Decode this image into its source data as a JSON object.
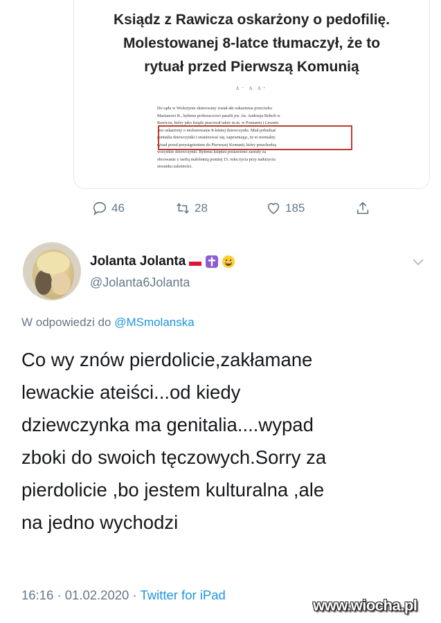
{
  "quoted_article": {
    "title_lines": [
      "Ksiądz z Rawicza oskarżony o pedofilię.",
      "Molestowanej 8-latce tłumaczył, że to",
      "rytuał przed Pierwszą Komunią"
    ],
    "font_size_controls": "A⁻  A  A⁺",
    "body_lines": [
      "Do sądu w Wolsztynie skierowany został akt oskarżenia przeciwko",
      "Marianowi B., byłemu proboszczowi parafii pw. św. Andrzeja Boboli w",
      "Rawiczu, który jako ksiądz pracował także m.in. w Poznaniu i Lesznie.",
      "Jest oskarżony o molestowanie 8-letniej dziewczynki. Miał pobudzać",
      "genitalia dziewczynki i onanizować się, zapewniając, że to normalny",
      "rytuał przed przystąpieniem do Pierwszej Komunii, który przechodzą",
      "wszystkie dziewczynki. Byłemu księdzu postawiono zarzuty za",
      "obcowanie z osobą małoletnią poniżej 15. roku życia przy nadużyciu",
      "stosunku zależności."
    ]
  },
  "actions": {
    "replies": "46",
    "retweets": "28",
    "likes": "185"
  },
  "tweet": {
    "display_name": "Jolanta Jolanta",
    "handle": "@Jolanta6Jolanta",
    "reply_prefix": "W odpowiedzi do ",
    "reply_mention": "@MSmolanska",
    "text_lines": [
      "Co wy znów pierdolicie,zakłamane",
      "lewackie ateiści...od kiedy",
      "dziewczynka ma genitalia....wypad",
      "zboki do swoich tęczowych.Sorry za",
      "pierdolicie ,bo jestem kulturalna ,ale",
      "na jedno wychodzi"
    ],
    "timestamp": "16:16 · 01.02.2020 · ",
    "source": "Twitter for iPad",
    "name_icons": [
      "poland-flag-icon",
      "cross-icon",
      "grinning-face-icon"
    ]
  },
  "watermark": "www.wiocha.pl",
  "colors": {
    "secondary_text": "#657786",
    "link": "#1b95e0",
    "highlight_border": "#c0392b"
  }
}
